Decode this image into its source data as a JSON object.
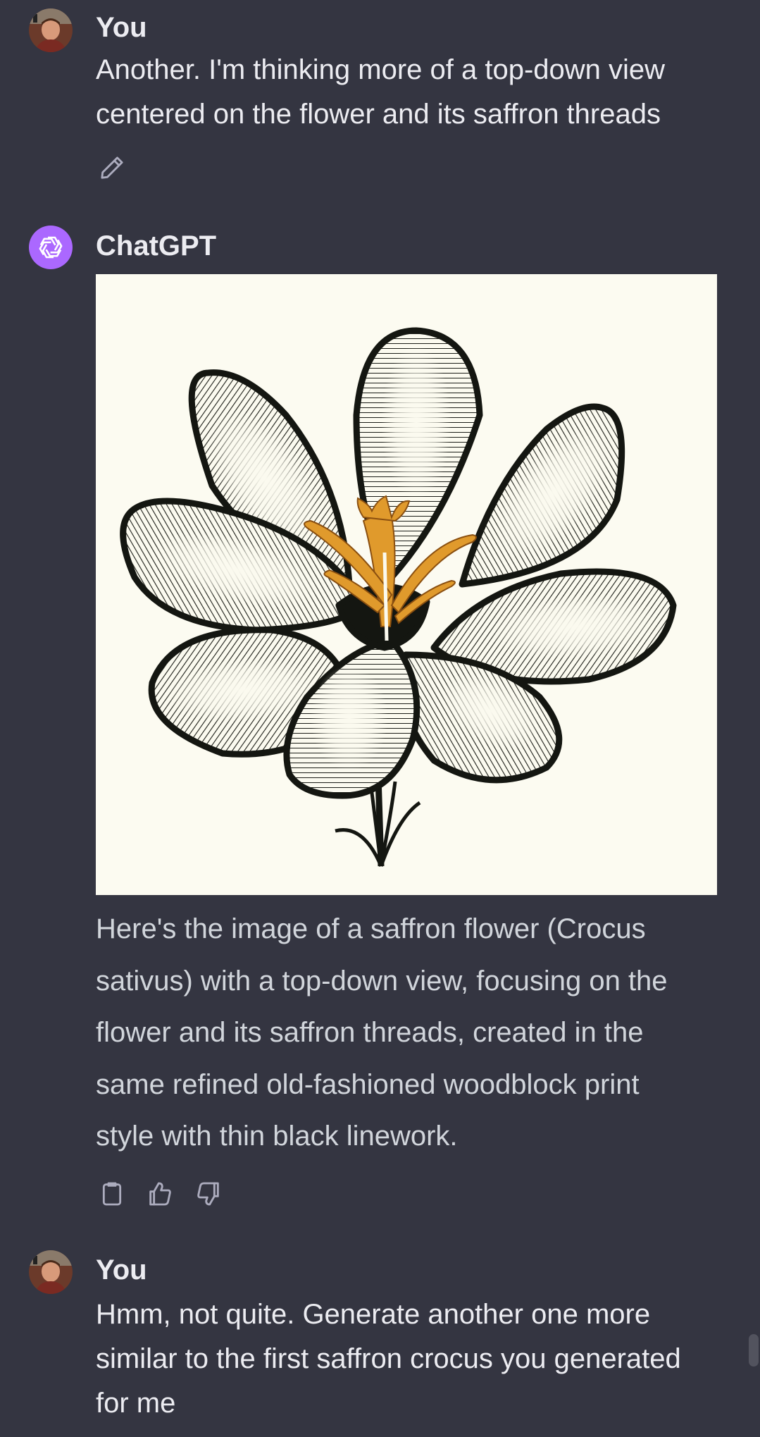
{
  "conversation": {
    "messages": [
      {
        "author": "You",
        "text_lines": [
          "Another.  I'm thinking more of a top-down view",
          "centered on the flower and its saffron threads"
        ],
        "edit_icon": "pencil-icon"
      },
      {
        "author": "ChatGPT",
        "image_description_icon": "saffron-crocus-woodblock-image",
        "text_lines": [
          "Here's the image of a saffron flower (Crocus",
          "sativus) with a top-down view, focusing on the",
          "flower and its saffron threads, created in the",
          "same refined old-fashioned woodblock print",
          "style with thin black linework."
        ],
        "action_icons": [
          "clipboard-icon",
          "thumbs-up-icon",
          "thumbs-down-icon"
        ]
      },
      {
        "author": "You",
        "text_lines": [
          "Hmm, not quite.  Generate another one more",
          "similar to the first saffron crocus you generated",
          "for me"
        ]
      }
    ]
  },
  "colors": {
    "background": "#343541",
    "text_primary": "#ececf1",
    "text_assistant": "#d1d5db",
    "assistant_avatar": "#ab68ff",
    "saffron": "#e09a2c"
  }
}
